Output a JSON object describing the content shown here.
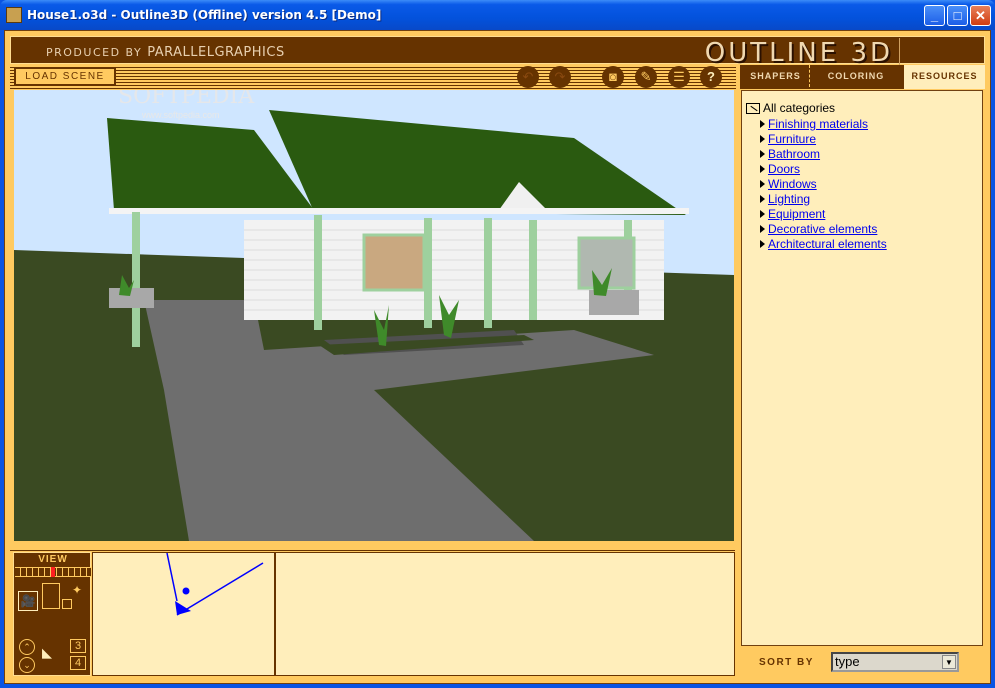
{
  "window": {
    "title": "House1.o3d - Outline3D (Offline) version 4.5 [Demo]",
    "controls": {
      "minimize": "_",
      "maximize": "□",
      "close": "✕"
    }
  },
  "header": {
    "produced_by": "PRODUCED BY",
    "company": "PARALLELGRAPHICS",
    "logo": "OUTLINE 3D"
  },
  "toolbar": {
    "load_scene": "LOAD SCENE",
    "icons": [
      {
        "name": "undo-icon",
        "glyph": "↶",
        "enabled": false
      },
      {
        "name": "redo-icon",
        "glyph": "↷",
        "enabled": false
      },
      {
        "name": "camera-snapshot-icon",
        "glyph": "◙"
      },
      {
        "name": "edit-pen-icon",
        "glyph": "✎"
      },
      {
        "name": "document-list-icon",
        "glyph": "☰"
      },
      {
        "name": "help-icon",
        "glyph": "?"
      }
    ]
  },
  "tabs": [
    {
      "label": "SHAPERS",
      "active": false
    },
    {
      "label": "COLORING",
      "active": false
    },
    {
      "label": "RESOURCES",
      "active": true
    }
  ],
  "viewport": {
    "watermark": "SOFTPEDIA",
    "watermark_url": "www.softpedia.com"
  },
  "resources": {
    "root": "All categories",
    "categories": [
      "Finishing materials",
      "Furniture",
      "Bathroom",
      "Doors",
      "Windows",
      "Lighting",
      "Equipment",
      "Decorative elements",
      "Architectural elements"
    ]
  },
  "sort": {
    "label": "SORT BY",
    "value": "type"
  },
  "view_panel": {
    "label": "VIEW",
    "view_numbers": [
      "3",
      "4"
    ],
    "zoom_plus": "+",
    "zoom_minus": "−"
  },
  "colors": {
    "brown": "#663300",
    "orange": "#ffca60",
    "cream": "#ffeebb",
    "link": "#0000ee",
    "sky": "#cfe6ff",
    "grass": "#3a4a22",
    "roof": "#2a5a10"
  }
}
